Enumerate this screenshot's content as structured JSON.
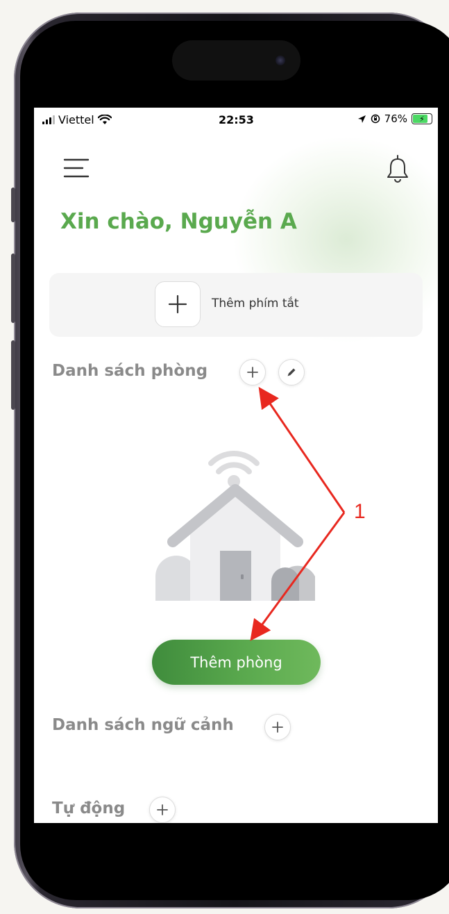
{
  "status_bar": {
    "carrier": "Viettel",
    "time": "22:53",
    "battery": "76%"
  },
  "header": {
    "menu_icon": "hamburger-menu-icon",
    "bell_icon": "bell-icon"
  },
  "greeting": "Xin chào, Nguyễn A",
  "shortcut": {
    "label": "Thêm phím tắt",
    "icon": "plus-icon"
  },
  "rooms": {
    "title": "Danh sách phòng",
    "add_room_label": "Thêm phòng"
  },
  "scenes": {
    "title": "Danh sách ngữ cảnh"
  },
  "automation": {
    "title": "Tự động"
  },
  "annotation": {
    "number": "1",
    "color": "#e8281f"
  },
  "colors": {
    "accent": "#5aa94e"
  }
}
